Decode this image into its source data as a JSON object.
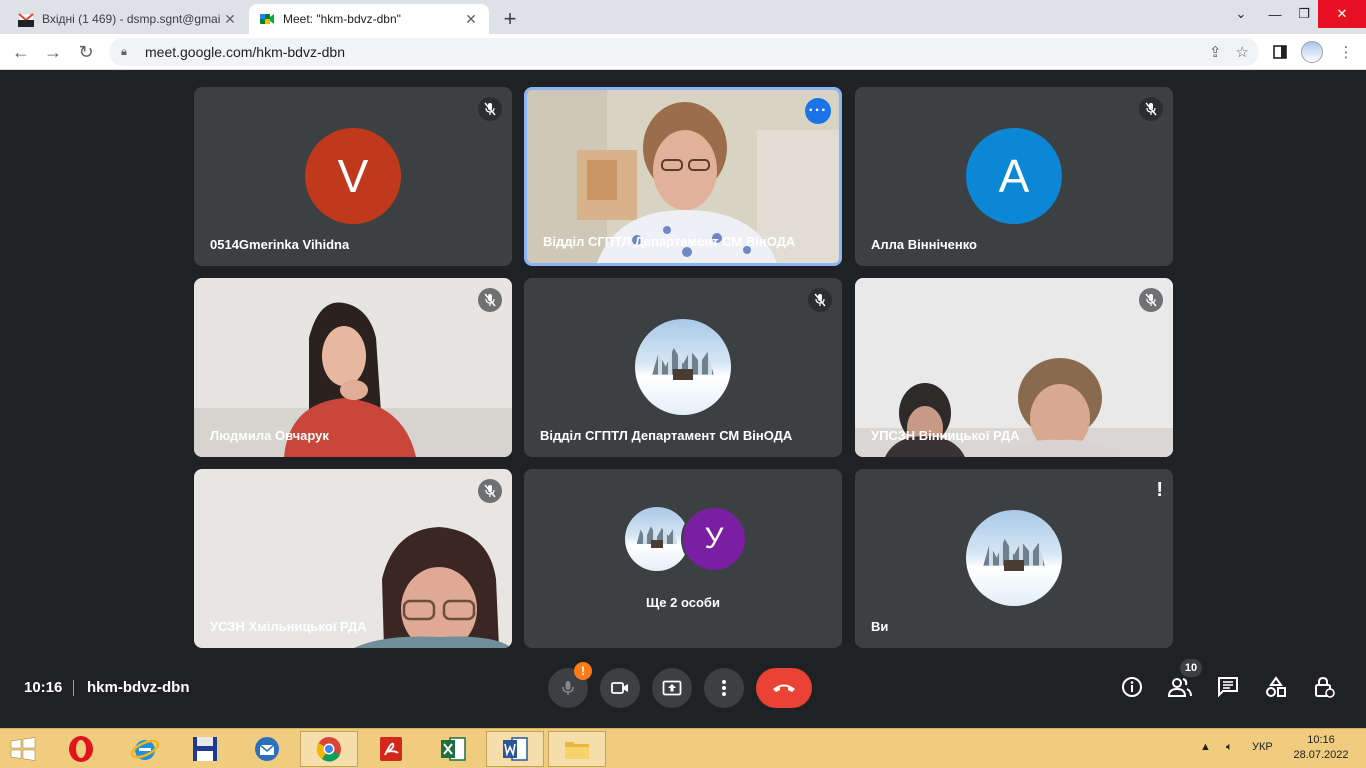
{
  "browser": {
    "tabs": [
      {
        "title": "Вхідні (1 469) - dsmp.sgnt@gmai",
        "active": false,
        "favicon": "gmail-icon",
        "favicon_badge": "100+"
      },
      {
        "title": "Meet: \"hkm-bdvz-dbn\"",
        "active": true,
        "favicon": "meet-icon"
      }
    ],
    "url": "meet.google.com/hkm-bdvz-dbn"
  },
  "tiles": [
    {
      "name": "0514Gmerinka Vihidna",
      "avatar_letter": "V",
      "avatar_color": "#c1391d",
      "muted": true
    },
    {
      "name": "Відділ СГПТЛ Департамент СМ ВінОДА",
      "video": true,
      "active_speaker": true
    },
    {
      "name": "Алла Вінніченко",
      "avatar_letter": "A",
      "avatar_color": "#0b87d5",
      "muted": true
    },
    {
      "name": "Людмила Овчарук",
      "video": true,
      "muted": true
    },
    {
      "name": "Відділ СГПТЛ Департамент СМ ВінОДА",
      "avatar_image": "snow-landscape",
      "muted": true
    },
    {
      "name": "УПСЗН Вінницької РДА",
      "video": true,
      "muted": true
    },
    {
      "name": "УСЗН Хмільницької РДА",
      "video": true,
      "muted": true
    },
    {
      "name": "Ще 2 особи",
      "avatar_letter": "У",
      "avatar_color": "#7b1fa2",
      "group": true
    },
    {
      "name": "Ви",
      "avatar_image": "snow-landscape",
      "warning": true
    }
  ],
  "meeting": {
    "time": "10:16",
    "code": "hkm-bdvz-dbn",
    "participants_count": "10",
    "mic_warning": "!"
  },
  "taskbar": {
    "language": "УКР",
    "time": "10:16",
    "date": "28.07.2022",
    "colors": {
      "bg": "#f0cc7e"
    }
  }
}
